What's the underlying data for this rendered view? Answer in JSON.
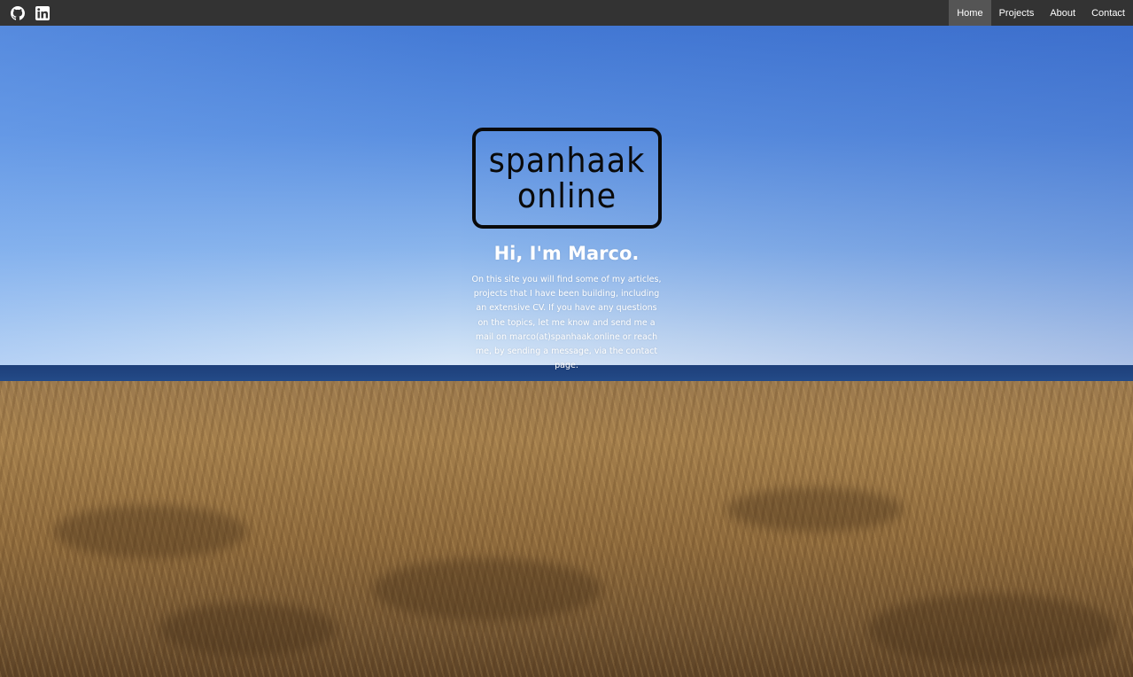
{
  "header": {
    "social": [
      {
        "icon": "github-icon"
      },
      {
        "icon": "linkedin-icon"
      }
    ],
    "nav": [
      {
        "label": "Home",
        "active": true
      },
      {
        "label": "Projects",
        "active": false
      },
      {
        "label": "About",
        "active": false
      },
      {
        "label": "Contact",
        "active": false
      }
    ]
  },
  "hero": {
    "logo_line1": "spanhaak",
    "logo_line2": "online",
    "greeting": "Hi, I'm Marco.",
    "intro": "On this site you will find some of my articles, projects that I have been building, including an extensive CV. If you have any questions on the topics, let me know and send me a mail on marco(at)spanhaak.online or reach me, by sending a message, via the contact page."
  },
  "colors": {
    "navbar_bg": "#333333",
    "nav_active_bg": "#555555",
    "text_light": "#ffffff"
  }
}
